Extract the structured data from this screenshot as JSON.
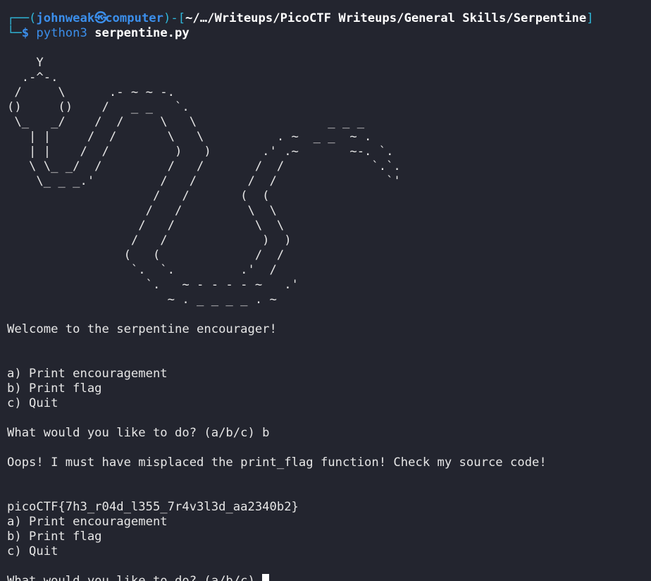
{
  "prompt": {
    "box_top": "┌──(",
    "user": "johnweak",
    "separator_icon": "㉿",
    "host": "computer",
    "mid": ")-[",
    "path": "~/…/Writeups/PicoCTF Writeups/General Skills/Serpentine",
    "close": "]",
    "box_bottom": "└─",
    "dollar": "$ ",
    "command": "python3",
    "argument": " serpentine.py"
  },
  "ascii_art": "    Y\n  .-^-.\n /     \\      .- ~ ~ -.\n()     ()    /   _ _   `.\n \\_   _/    /  /     \\   \\                  _ _ _\n   | |     /  /       \\   \\          . ~  _ _  ~ .\n   | |    /  /         )   )       .' .~       ~-. `.\n   \\ \\_ _/  /         /   /       /  /            `.`.\n    \\_ _ _.'         /   /       /  /               `'\n                    /   /       (  (\n                   /   /         \\  \\\n                  /   /           \\  \\\n                 /   /             )  )\n                (   (             /  /\n                 `.  `.         .'  /\n                   `.   ~ - - - - ~   .'\n                      ~ . _ _ _ _ . ~",
  "output": {
    "welcome": "Welcome to the serpentine encourager!",
    "menu1": [
      "a) Print encouragement",
      "b) Print flag",
      "c) Quit"
    ],
    "question1": "What would you like to do? (a/b/c) b",
    "oops": "Oops! I must have misplaced the print_flag function! Check my source code!",
    "flag": "picoCTF{7h3_r04d_l355_7r4v3l3d_aa2340b2}",
    "menu2": [
      "a) Print encouragement",
      "b) Print flag",
      "c) Quit"
    ],
    "question2": "What would you like to do? (a/b/c) "
  },
  "colors": {
    "background": "#23252f",
    "text": "#e6e6e6",
    "prompt_blue": "#3b8eea",
    "prompt_cyan": "#2fb7d9"
  }
}
